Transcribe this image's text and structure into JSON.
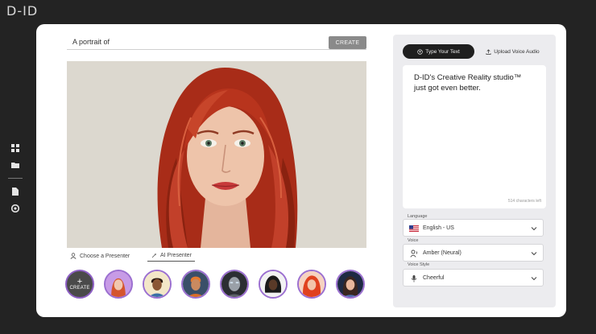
{
  "app": {
    "logo_text": "D-ID"
  },
  "prompt": {
    "text": "A portrait of",
    "create_label": "CREATE"
  },
  "presenter_tabs": {
    "choose_label": "Choose a Presenter",
    "ai_label": "AI Presenter"
  },
  "avatars": {
    "create_label": "CREATE"
  },
  "panel": {
    "type_text_label": "Type Your Text",
    "upload_audio_label": "Upload Voice Audio",
    "script_text": "D-ID's Creative Reality studio™ just got even better.",
    "char_count": "514 characters left",
    "language": {
      "label": "Language",
      "value": "English - US"
    },
    "voice": {
      "label": "Voice",
      "value": "Amber (Neural)"
    },
    "voice_style": {
      "label": "Voice Style",
      "value": "Cheerful"
    }
  },
  "colors": {
    "accent": "#9b6fd0",
    "dark_button": "#1f1f1f",
    "hair": "#b2311b",
    "background": "#232323"
  }
}
